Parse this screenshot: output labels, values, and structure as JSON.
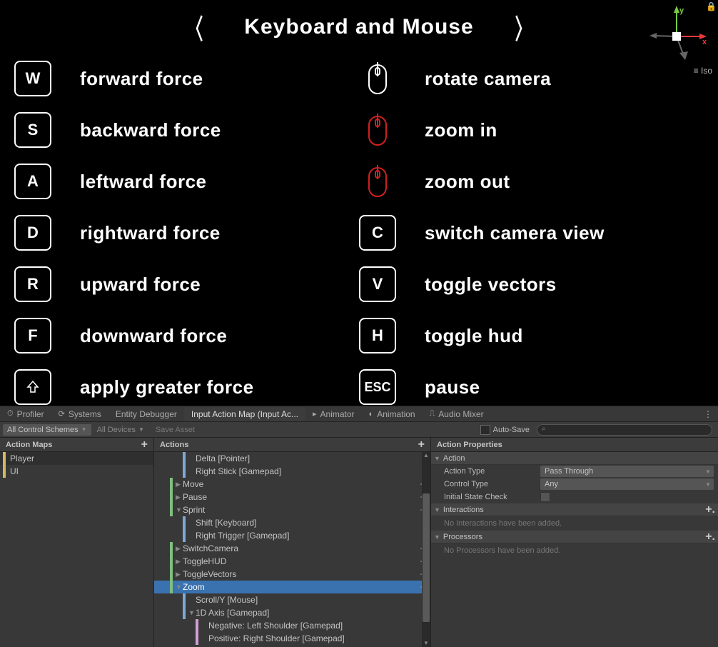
{
  "game": {
    "title": "Keyboard and Mouse",
    "iso_label": "Iso",
    "left_col": [
      {
        "key": "W",
        "label": "forward force",
        "type": "key"
      },
      {
        "key": "S",
        "label": "backward force",
        "type": "key"
      },
      {
        "key": "A",
        "label": "leftward force",
        "type": "key"
      },
      {
        "key": "D",
        "label": "rightward force",
        "type": "key"
      },
      {
        "key": "R",
        "label": "upward force",
        "type": "key"
      },
      {
        "key": "F",
        "label": "downward force",
        "type": "key"
      },
      {
        "key": "⇧",
        "label": "apply greater force",
        "type": "key-shift"
      }
    ],
    "right_col": [
      {
        "key": "mouse-white",
        "label": "rotate camera",
        "type": "mouse"
      },
      {
        "key": "mouse-red",
        "label": "zoom in",
        "type": "mouse"
      },
      {
        "key": "mouse-red",
        "label": "zoom out",
        "type": "mouse"
      },
      {
        "key": "C",
        "label": "switch camera view",
        "type": "key"
      },
      {
        "key": "V",
        "label": "toggle vectors",
        "type": "key"
      },
      {
        "key": "H",
        "label": "toggle HUD",
        "type": "key"
      },
      {
        "key": "ESC",
        "label": "pause",
        "type": "key-esc"
      }
    ]
  },
  "editor": {
    "tabs": [
      {
        "label": "Profiler",
        "icon": "⏱"
      },
      {
        "label": "Systems",
        "icon": "⟳"
      },
      {
        "label": "Entity Debugger",
        "icon": ""
      },
      {
        "label": "Input Action Map (Input Ac...",
        "icon": "",
        "active": true
      },
      {
        "label": "Animator",
        "icon": "▸"
      },
      {
        "label": "Animation",
        "icon": "◐"
      },
      {
        "label": "Audio Mixer",
        "icon": "⎍"
      }
    ],
    "toolbar": {
      "scheme": "All Control Schemes",
      "devices": "All Devices",
      "save": "Save Asset",
      "autosave": "Auto-Save",
      "search_placeholder": ""
    },
    "maps_title": "Action Maps",
    "actions_title": "Actions",
    "props_title": "Action Properties",
    "maps": [
      {
        "label": "Player",
        "selected": true
      },
      {
        "label": "UI",
        "selected": false
      }
    ],
    "actions": [
      {
        "indent": 2,
        "bar": "blue",
        "fold": "",
        "label": "Delta [Pointer]"
      },
      {
        "indent": 2,
        "bar": "blue",
        "fold": "",
        "label": "Right Stick [Gamepad]"
      },
      {
        "indent": 1,
        "bar": "green",
        "fold": "▶",
        "label": "Move",
        "add": true
      },
      {
        "indent": 1,
        "bar": "green",
        "fold": "▶",
        "label": "Pause",
        "add": true
      },
      {
        "indent": 1,
        "bar": "green",
        "fold": "▼",
        "label": "Sprint",
        "add": true
      },
      {
        "indent": 2,
        "bar": "blue",
        "fold": "",
        "label": "Shift [Keyboard]"
      },
      {
        "indent": 2,
        "bar": "blue",
        "fold": "",
        "label": "Right Trigger [Gamepad]"
      },
      {
        "indent": 1,
        "bar": "green",
        "fold": "▶",
        "label": "SwitchCamera",
        "add": true
      },
      {
        "indent": 1,
        "bar": "green",
        "fold": "▶",
        "label": "ToggleHUD",
        "add": true
      },
      {
        "indent": 1,
        "bar": "green",
        "fold": "▶",
        "label": "ToggleVectors",
        "add": true
      },
      {
        "indent": 1,
        "bar": "green",
        "fold": "▼",
        "label": "Zoom",
        "add": true,
        "selected": true
      },
      {
        "indent": 2,
        "bar": "blue",
        "fold": "",
        "label": "Scroll/Y [Mouse]"
      },
      {
        "indent": 2,
        "bar": "blue",
        "fold": "▼",
        "label": "1D Axis [Gamepad]"
      },
      {
        "indent": 3,
        "bar": "pink",
        "fold": "",
        "label": "Negative: Left Shoulder [Gamepad]"
      },
      {
        "indent": 3,
        "bar": "pink",
        "fold": "",
        "label": "Positive: Right Shoulder [Gamepad]"
      }
    ],
    "props": {
      "action_section": "Action",
      "action_type_label": "Action Type",
      "action_type_value": "Pass Through",
      "control_type_label": "Control Type",
      "control_type_value": "Any",
      "initial_state_label": "Initial State Check",
      "interactions_section": "Interactions",
      "interactions_empty": "No Interactions have been added.",
      "processors_section": "Processors",
      "processors_empty": "No Processors have been added."
    }
  }
}
